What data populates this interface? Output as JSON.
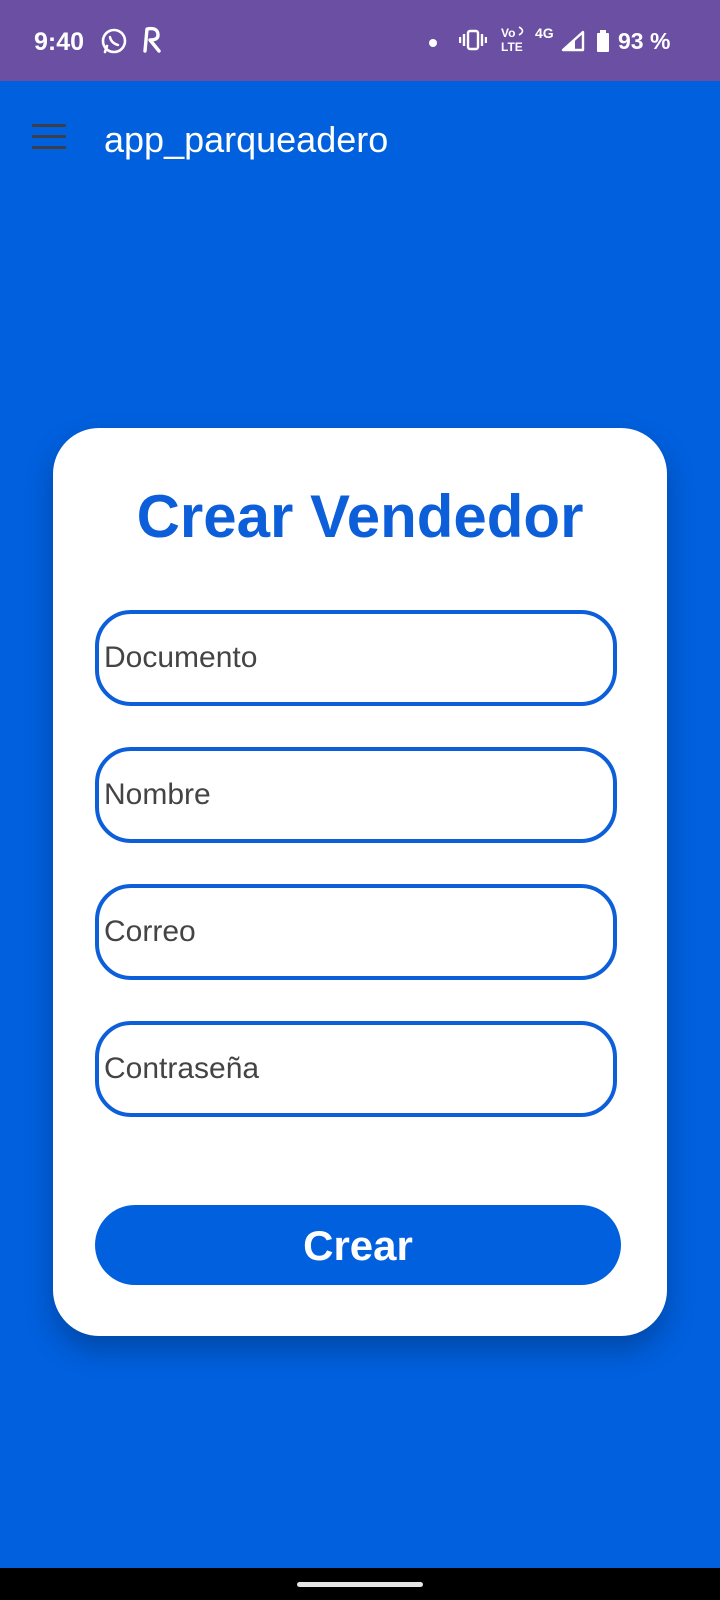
{
  "status_bar": {
    "time": "9:40",
    "left_icons": [
      "whatsapp-icon",
      "r-app-icon"
    ],
    "vo_label": "Vo",
    "lte_label": "LTE",
    "network_label": "4G",
    "battery_percent": "93 %",
    "background": "#6A4FA3"
  },
  "app_bar": {
    "title": "app_parqueadero",
    "menu_icon": "hamburger-menu-icon"
  },
  "form": {
    "title": "Crear Vendedor",
    "fields": {
      "documento": {
        "placeholder": "Documento",
        "value": ""
      },
      "nombre": {
        "placeholder": "Nombre",
        "value": ""
      },
      "correo": {
        "placeholder": "Correo",
        "value": ""
      },
      "contrasena": {
        "placeholder": "Contraseña",
        "value": ""
      }
    },
    "submit_label": "Crear"
  },
  "colors": {
    "background": "#0060DE",
    "accent": "#0D5FD9",
    "card": "#FFFFFF"
  }
}
